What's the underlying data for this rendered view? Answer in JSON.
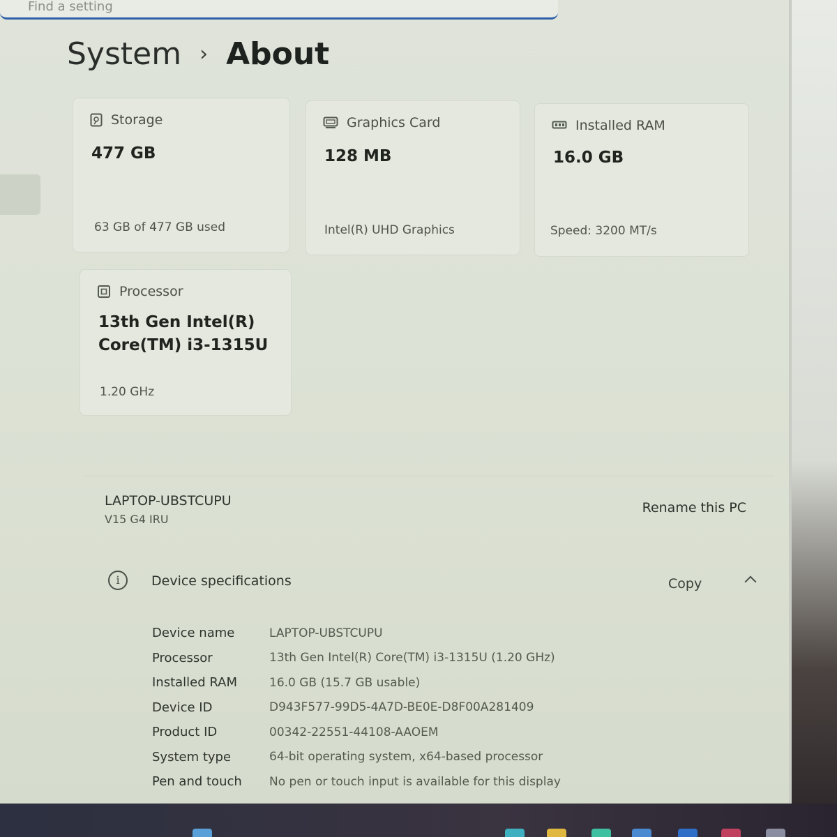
{
  "search": {
    "placeholder": "Find a setting"
  },
  "breadcrumb": {
    "root": "System",
    "separator": "›",
    "current": "About"
  },
  "cards": {
    "storage": {
      "label": "Storage",
      "value": "477 GB",
      "sub": "63 GB of 477 GB used"
    },
    "graphics": {
      "label": "Graphics Card",
      "value": "128 MB",
      "sub": "Intel(R) UHD Graphics"
    },
    "ram": {
      "label": "Installed RAM",
      "value": "16.0 GB",
      "sub": "Speed: 3200 MT/s"
    },
    "processor": {
      "label": "Processor",
      "value_line1": "13th Gen Intel(R)",
      "value_line2": "Core(TM) i3-1315U",
      "sub": "1.20 GHz"
    }
  },
  "pc": {
    "name": "LAPTOP-UBSTCUPU",
    "model": "V15 G4 IRU",
    "rename_label": "Rename this PC"
  },
  "specs": {
    "title": "Device specifications",
    "copy_label": "Copy",
    "rows": [
      {
        "key": "Device name",
        "value": "LAPTOP-UBSTCUPU"
      },
      {
        "key": "Processor",
        "value": "13th Gen Intel(R) Core(TM) i3-1315U (1.20 GHz)"
      },
      {
        "key": "Installed RAM",
        "value": "16.0 GB (15.7 GB usable)"
      },
      {
        "key": "Device ID",
        "value": "D943F577-99D5-4A7D-BE0E-D8F00A281409"
      },
      {
        "key": "Product ID",
        "value": "00342-22551-44108-AAOEM"
      },
      {
        "key": "System type",
        "value": "64-bit operating system, x64-based processor"
      },
      {
        "key": "Pen and touch",
        "value": "No pen or touch input is available for this display"
      }
    ]
  },
  "colors": {
    "accent": "#2f5fa8"
  }
}
